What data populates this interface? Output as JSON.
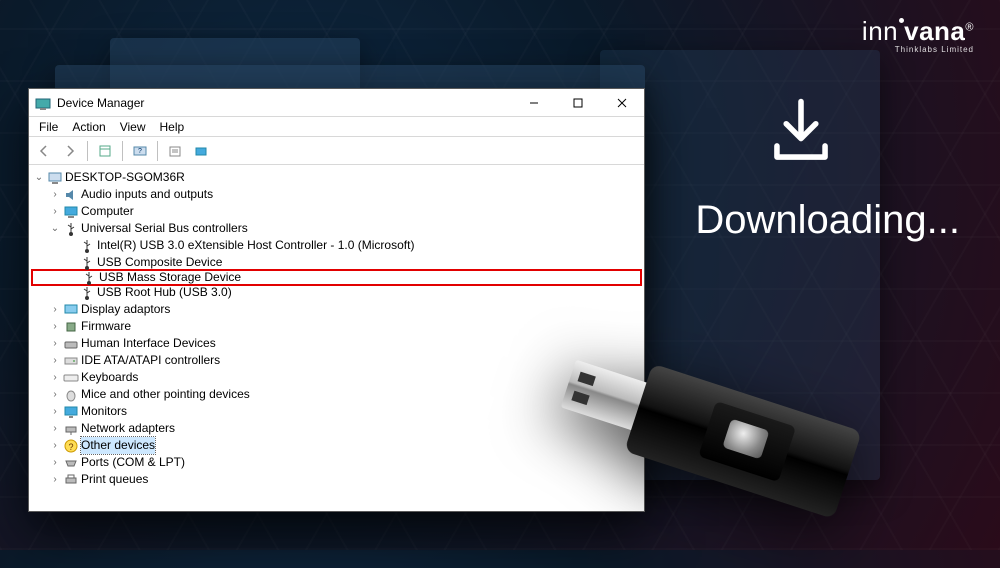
{
  "brand": {
    "name": "innovana",
    "tagline": "Thinklabs Limited"
  },
  "downloading_label": "Downloading...",
  "dm": {
    "title": "Device Manager",
    "menu": {
      "file": "File",
      "action": "Action",
      "view": "View",
      "help": "Help"
    },
    "root": "DESKTOP-SGOM36R",
    "items": {
      "audio": "Audio inputs and outputs",
      "computer": "Computer",
      "usb_controllers": "Universal Serial Bus controllers",
      "usb_intel": "Intel(R) USB 3.0 eXtensible Host Controller - 1.0 (Microsoft)",
      "usb_composite": "USB Composite Device",
      "usb_mass_storage": "USB Mass Storage Device",
      "usb_root_hub": "USB Root Hub (USB 3.0)",
      "display": "Display adaptors",
      "firmware": "Firmware",
      "hid": "Human Interface Devices",
      "ide": "IDE ATA/ATAPI controllers",
      "keyboards": "Keyboards",
      "mice": "Mice and other pointing devices",
      "monitors": "Monitors",
      "network": "Network adapters",
      "other": "Other devices",
      "ports": "Ports (COM & LPT)",
      "print": "Print queues"
    }
  }
}
